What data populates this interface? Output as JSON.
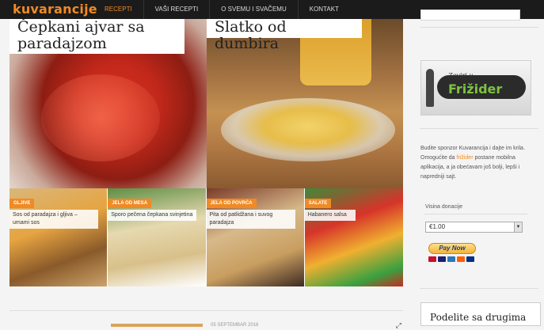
{
  "header": {
    "logo": "kuvarancije",
    "nav": [
      {
        "label": "RECEPTI",
        "active": true
      },
      {
        "label": "VAŠI RECEPTI",
        "active": false
      },
      {
        "label": "O SVEMU I SVAČEMU",
        "active": false
      },
      {
        "label": "KONTAKT",
        "active": false
      }
    ]
  },
  "featured": [
    {
      "title": "Čepkani ajvar sa paradajzom"
    },
    {
      "title": "Slatko od dumbira"
    }
  ],
  "tiles": [
    {
      "category": "GLJIVE",
      "title": "Sos od paradajza i gljiva – umami sos"
    },
    {
      "category": "JELA OD MESA",
      "title": "Sporo pečena čepkana svinjetina"
    },
    {
      "category": "JELA OD POVRĆA",
      "title": "Pita od patlidžana i suvog paradajza"
    },
    {
      "category": "SALATE",
      "title": "Habanero salsa"
    }
  ],
  "sidebar": {
    "banner_small": "Zaviri u",
    "banner_big": "Frižider",
    "sponsor_text_before": "Budite sponzor Kuvarancija i dajte im krila. Omogućite da ",
    "sponsor_highlight": "frižider",
    "sponsor_text_after": " postane mobilna aplikacija, a ja obećavam još bolji, lepši i napredniji sajt.",
    "donation_label": "Visina donacije",
    "donation_value": "€1.00",
    "paynow_label": "Pay Now",
    "share_title": "Podelite sa drugima"
  },
  "bottom_meta": "05 SEPTEMBAR 2016",
  "colors": {
    "accent": "#f08a24",
    "topbar": "#1b1b1b",
    "banner_green": "#7cc242"
  }
}
